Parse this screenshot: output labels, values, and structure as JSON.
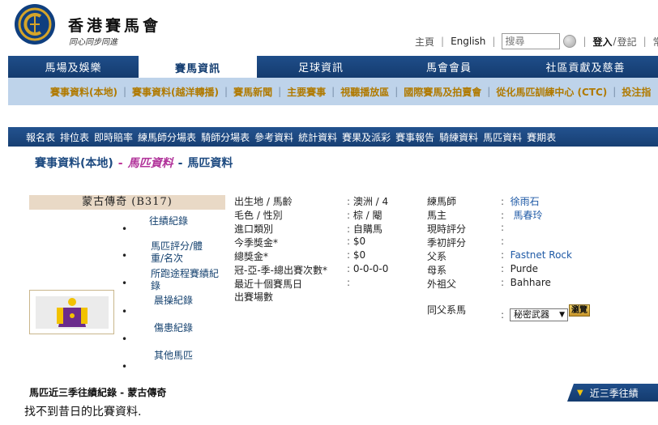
{
  "header": {
    "brand_zh": "香港賽馬會",
    "slogan": "同心同步同進"
  },
  "topbar": {
    "home": "主頁",
    "english": "English",
    "search_placeholder": "搜尋",
    "login": "登入",
    "register": "登記",
    "more": "常"
  },
  "main_nav": {
    "tabs": [
      {
        "label": "馬場及娛樂"
      },
      {
        "label": "賽馬資訊"
      },
      {
        "label": "足球資訊"
      },
      {
        "label": "馬會會員"
      },
      {
        "label": "社區貢獻及慈善"
      }
    ]
  },
  "sub_nav": {
    "items": [
      "賽事資料(本地)",
      "賽事資料(越洋轉播)",
      "賽馬新聞",
      "主要賽事",
      "視聽播放區",
      "國際賽馬及拍賣會",
      "從化馬匹訓練中心 (CTC)",
      "投注指"
    ]
  },
  "info_nav": {
    "items": [
      "報名表",
      "排位表",
      "即時賠率",
      "練馬師分場表",
      "騎師分場表",
      "參考資料",
      "統計資料",
      "賽果及派彩",
      "賽事報告",
      "騎練資料",
      "馬匹資料",
      "賽期表"
    ]
  },
  "breadcrumb": {
    "part1": "賽事資料(本地)",
    "sep": "-",
    "part2": "馬匹資料",
    "part3": "馬匹資料"
  },
  "horse": {
    "name_bar": "蒙古傳奇 (B317)"
  },
  "side_menu": {
    "items": [
      "往績紀錄",
      "馬匹評分/體重/名次",
      "所跑途程賽績紀錄",
      "晨操紀錄",
      "傷患紀錄",
      "其他馬匹"
    ],
    "bullet": "•"
  },
  "details_left": [
    {
      "label": "出生地 / 馬齡",
      "value": "澳洲 / 4"
    },
    {
      "label": "毛色 / 性別",
      "value": "棕 / 閹"
    },
    {
      "label": "進口類別",
      "value": "自購馬"
    },
    {
      "label": "今季獎金*",
      "value": "$0"
    },
    {
      "label": "總獎金*",
      "value": "$0"
    },
    {
      "label": "冠-亞-季-總出賽次數*",
      "value": "0-0-0-0"
    },
    {
      "label": "最近十個賽馬日",
      "value": ""
    },
    {
      "label": "出賽場數",
      "value": ""
    }
  ],
  "details_right": [
    {
      "label": "練馬師",
      "value": "徐雨石"
    },
    {
      "label": "馬主",
      "value": "馬春玲"
    },
    {
      "label": "現時評分",
      "value": ""
    },
    {
      "label": "季初評分",
      "value": ""
    },
    {
      "label": "父系",
      "value": "Fastnet Rock"
    },
    {
      "label": "母系",
      "value": "Purde"
    },
    {
      "label": "外祖父",
      "value": "Bahhare"
    }
  ],
  "sire_group": {
    "label": "同父系馬",
    "selected": "秘密武器",
    "browse_label": "瀏覽"
  },
  "records": {
    "title": "馬匹近三季往績紀錄 - 蒙古傳奇",
    "empty_message": "找不到昔日的比賽資料.",
    "tab_label": "近三季往績"
  },
  "colors": {
    "nav_blue": "#1a4580",
    "subnav_bg": "#bed3ea",
    "subnav_text": "#b07a00",
    "name_bar_bg": "#e9d9c6",
    "link_blue": "#1f5aa6",
    "breadcrumb_pink": "#b1339a"
  }
}
